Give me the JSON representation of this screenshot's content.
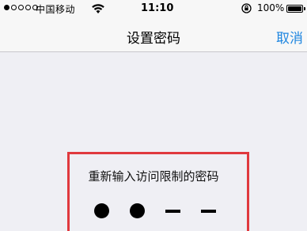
{
  "status_bar": {
    "carrier": "中国移动",
    "time": "11:10",
    "battery_percent": "100%",
    "signal_strength_dots_filled": 1,
    "signal_strength_dots_total": 5,
    "icons": [
      "wifi-icon",
      "rotation-lock-icon",
      "battery-icon"
    ]
  },
  "nav": {
    "title": "设置密码",
    "cancel_label": "取消"
  },
  "passcode": {
    "prompt": "重新输入访问限制的密码",
    "digits_total": 4,
    "digits_entered": 2
  },
  "colors": {
    "accent": "#1f86e0",
    "highlight_border": "#e0393e",
    "background": "#efeff4"
  }
}
